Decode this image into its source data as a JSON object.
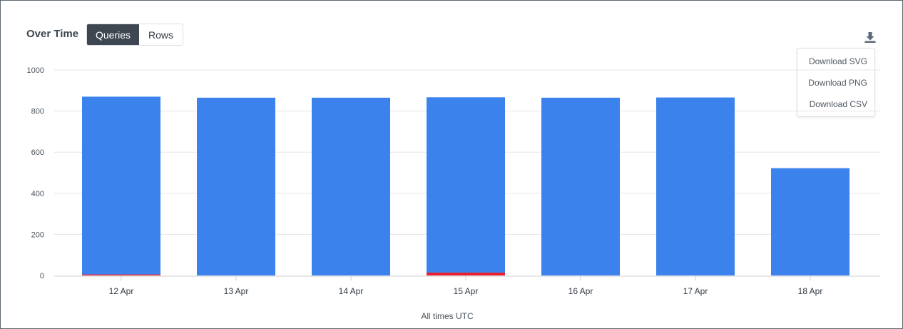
{
  "header": {
    "title": "Over Time",
    "toggle": {
      "options": [
        "Queries",
        "Rows"
      ],
      "selected": "Queries"
    }
  },
  "export_menu": {
    "icon": "download-icon",
    "items": [
      "Download SVG",
      "Download PNG",
      "Download CSV"
    ]
  },
  "footer": {
    "caption": "All times UTC"
  },
  "colors": {
    "blue": "#3b82ec",
    "red": "#e8202e",
    "grid": "#e6e6e6",
    "axis": "#cccccc"
  },
  "chart_data": {
    "type": "bar",
    "stacked": true,
    "categories": [
      "12 Apr",
      "13 Apr",
      "14 Apr",
      "15 Apr",
      "16 Apr",
      "17 Apr",
      "18 Apr"
    ],
    "series": [
      {
        "values": [
          865,
          865,
          865,
          853,
          865,
          866,
          522
        ],
        "color": "#3b82ec"
      },
      {
        "values": [
          5,
          0,
          0,
          14,
          0,
          0,
          0
        ],
        "color": "#e8202e"
      }
    ],
    "yticks": [
      0,
      200,
      400,
      600,
      800,
      1000
    ],
    "ylim": [
      0,
      1000
    ],
    "grid": true
  }
}
